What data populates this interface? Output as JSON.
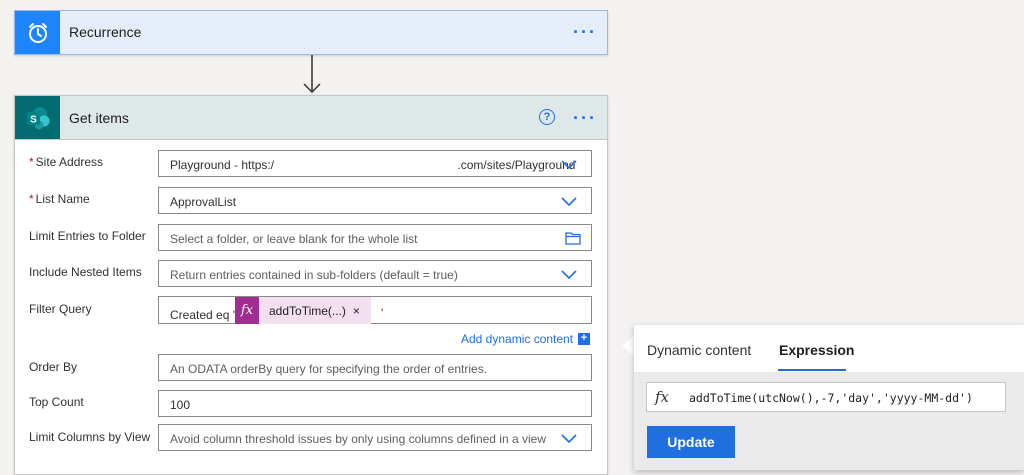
{
  "recurrence": {
    "title": "Recurrence"
  },
  "get_items": {
    "title": "Get items",
    "help_glyph": "?",
    "fields": {
      "site_address": {
        "label": "Site Address",
        "value": "Playground - https:/                                                       .com/sites/Playground"
      },
      "list_name": {
        "label": "List Name",
        "value": "ApprovalList"
      },
      "limit_folder": {
        "label": "Limit Entries to Folder",
        "placeholder": "Select a folder, or leave blank for the whole list"
      },
      "nested_items": {
        "label": "Include Nested Items",
        "placeholder": "Return entries contained in sub-folders (default = true)"
      },
      "filter_query": {
        "label": "Filter Query",
        "prefix": "Created eq '",
        "token_label": "addToTime(...)",
        "token_close": "×",
        "suffix": "'"
      },
      "order_by": {
        "label": "Order By",
        "placeholder": "An ODATA orderBy query for specifying the order of entries."
      },
      "top_count": {
        "label": "Top Count",
        "value": "100"
      },
      "limit_columns": {
        "label": "Limit Columns by View",
        "placeholder": "Avoid column threshold issues by only using columns defined in a view"
      }
    },
    "add_dynamic_content": "Add dynamic content",
    "add_plus": "+",
    "required_mark": "*"
  },
  "expression_panel": {
    "tabs": [
      "Dynamic content",
      "Expression"
    ],
    "active_tab": "Expression",
    "fx_glyph": "fx",
    "expression": "addToTime(utcNow(),-7,'day','yyyy-MM-dd')",
    "update_label": "Update"
  },
  "colors": {
    "recurrence_accent": "#1f85ff",
    "sharepoint_accent": "#036c70",
    "link_blue": "#1f6fe0",
    "token_accent": "#a12d93",
    "required_red": "#a4262c"
  },
  "icons": {
    "recurrence": "alarm-clock-icon",
    "get_items": "sharepoint-icon",
    "menu": "ellipsis-icon",
    "help": "help-circle-icon",
    "dropdown": "chevron-down-icon",
    "folder": "folder-icon",
    "function": "fx-icon",
    "remove": "close-icon"
  }
}
